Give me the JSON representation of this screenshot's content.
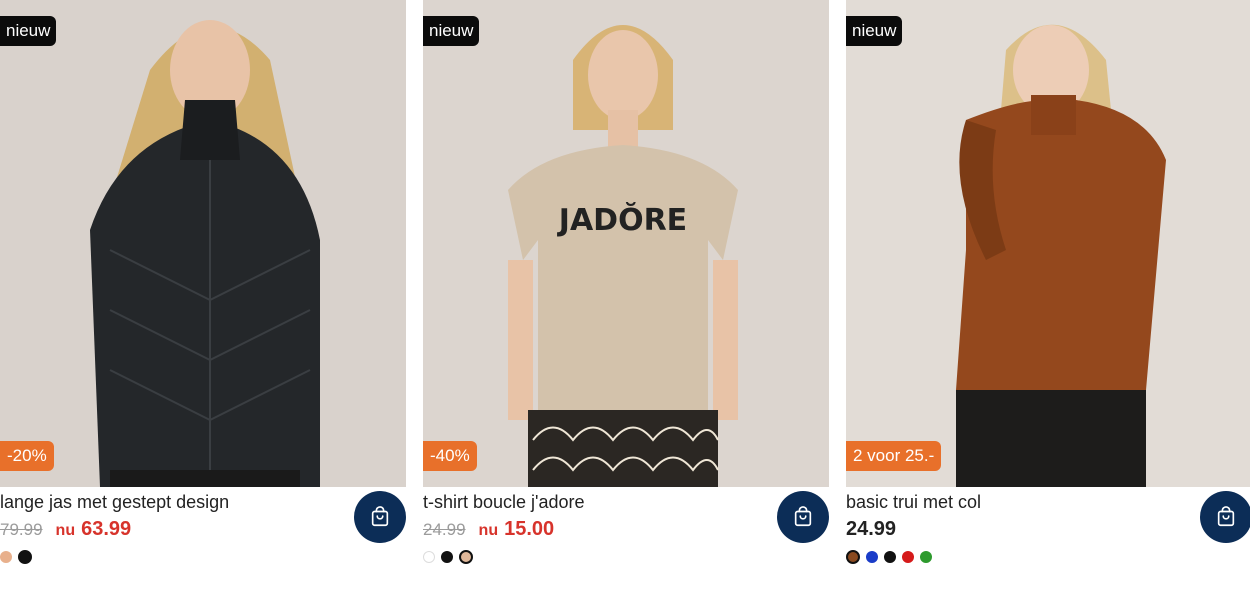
{
  "colors": {
    "accent": "#e8702a",
    "price_red": "#d7332b",
    "cart_bg": "#0c2d57"
  },
  "products": [
    {
      "badge_new": "nieuw",
      "badge_promo": "-20%",
      "title": "lange jas met gestept design",
      "old_price": "79.99",
      "nu_label": "nu",
      "price": "63.99",
      "swatches": [
        "#e8b08c",
        "#111111"
      ],
      "selected_swatch": 1
    },
    {
      "badge_new": "nieuw",
      "badge_promo": "-40%",
      "title": "t-shirt boucle j'adore",
      "old_price": "24.99",
      "nu_label": "nu",
      "price": "15.00",
      "swatches": [
        "#ffffff",
        "#111111",
        "#e0b89a"
      ],
      "selected_swatch": 2
    },
    {
      "badge_new": "nieuw",
      "badge_promo": "2 voor 25.-",
      "title": "basic trui met col",
      "price": "24.99",
      "swatches": [
        "#8a4a20",
        "#1a3cc8",
        "#111111",
        "#d51a1a",
        "#2d9a2d"
      ],
      "selected_swatch": 0
    }
  ]
}
